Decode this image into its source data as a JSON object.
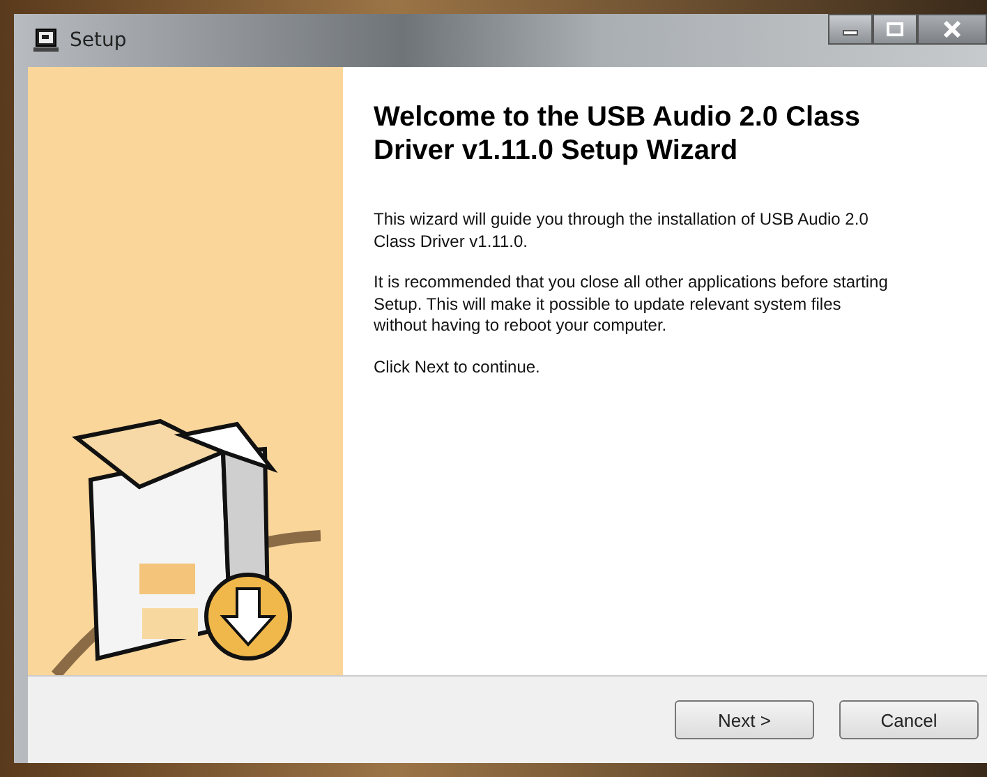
{
  "window": {
    "title": "Setup"
  },
  "heading": "Welcome to the USB Audio 2.0 Class Driver v1.11.0 Setup Wizard",
  "paragraphs": [
    "This wizard will guide you through the installation of USB Audio 2.0 Class Driver v1.11.0.",
    "It is recommended that you close all other applications before starting Setup. This will make it possible to update relevant system files without having to reboot your computer.",
    "Click Next to continue."
  ],
  "buttons": [
    {
      "label": "Next >"
    },
    {
      "label": "Cancel"
    }
  ]
}
